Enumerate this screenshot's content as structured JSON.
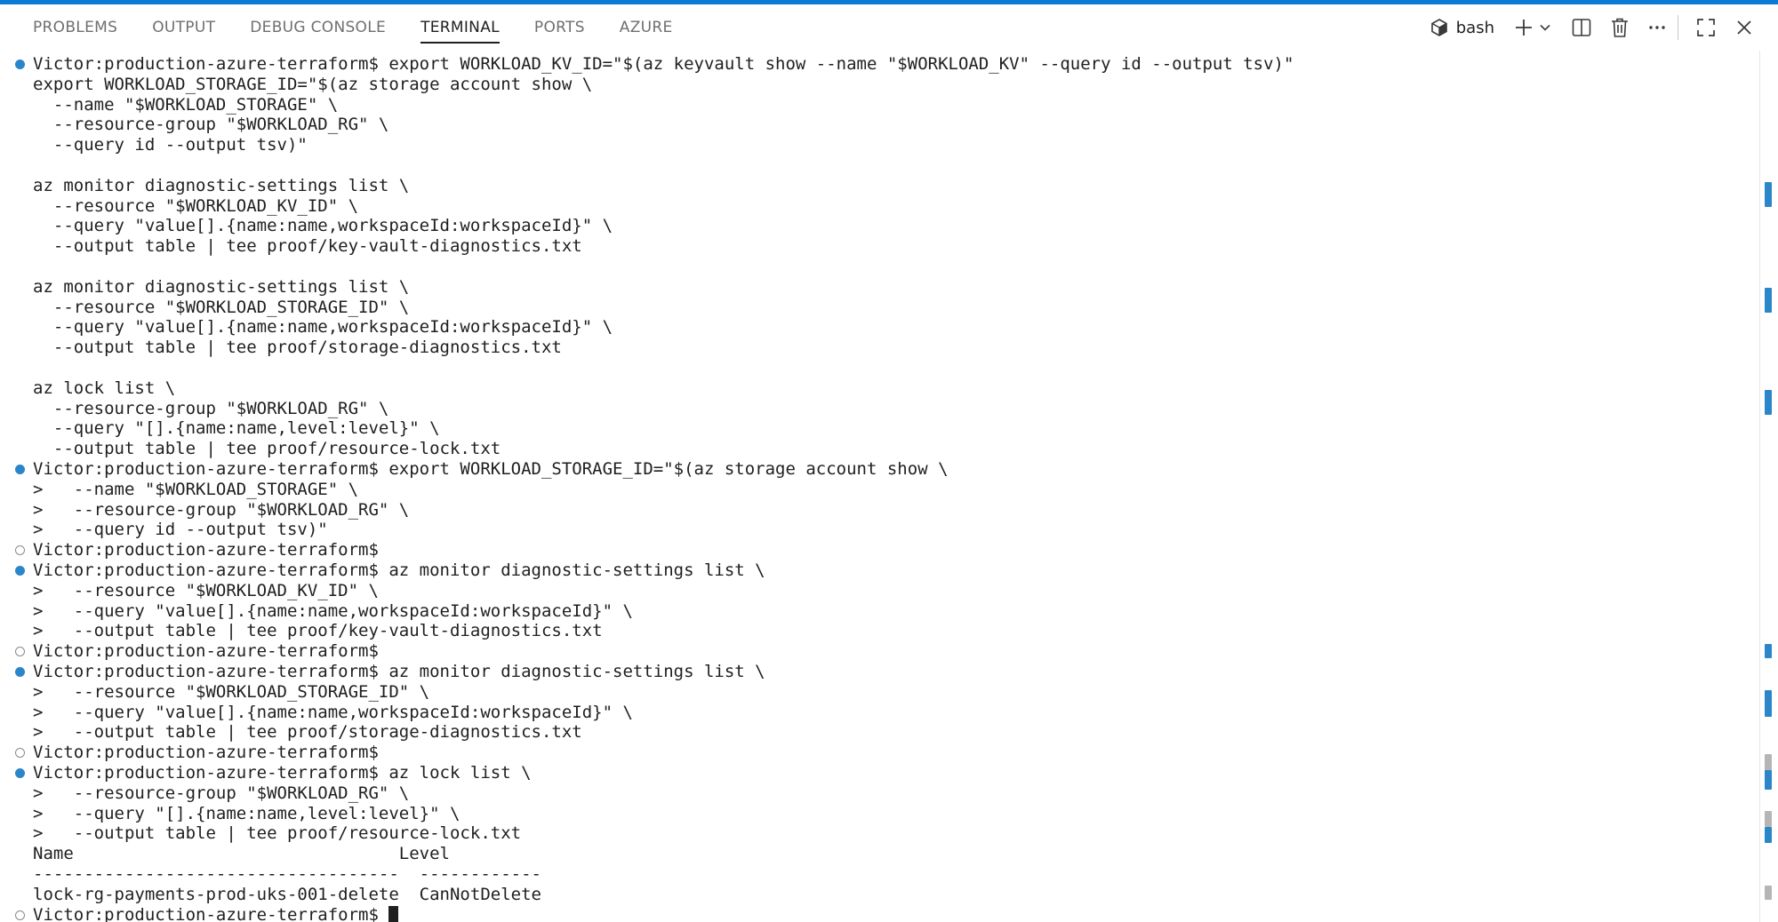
{
  "panel": {
    "tabs": [
      {
        "label": "PROBLEMS",
        "active": false
      },
      {
        "label": "OUTPUT",
        "active": false
      },
      {
        "label": "DEBUG CONSOLE",
        "active": false
      },
      {
        "label": "TERMINAL",
        "active": true
      },
      {
        "label": "PORTS",
        "active": false
      },
      {
        "label": "AZURE",
        "active": false
      }
    ],
    "terminal_name": "bash",
    "action_icons": [
      "terminal-icon",
      "plus-icon",
      "chevron-down-icon",
      "split-icon",
      "trash-icon",
      "ellipsis-icon",
      "maximize-icon",
      "close-icon"
    ]
  },
  "colors": {
    "accent": "#0a7bd5",
    "decoration_success": "#2a86c8",
    "decoration_empty": "#8a8a8a",
    "text": "#1f1f1f",
    "inactive_tab": "#6f6f6f"
  },
  "terminal": {
    "lines": [
      {
        "deco": "blue",
        "text": "Victor:production-azure-terraform$ export WORKLOAD_KV_ID=\"$(az keyvault show --name \"$WORKLOAD_KV\" --query id --output tsv)\""
      },
      {
        "deco": "none",
        "text": "export WORKLOAD_STORAGE_ID=\"$(az storage account show \\"
      },
      {
        "deco": "none",
        "text": "  --name \"$WORKLOAD_STORAGE\" \\"
      },
      {
        "deco": "none",
        "text": "  --resource-group \"$WORKLOAD_RG\" \\"
      },
      {
        "deco": "none",
        "text": "  --query id --output tsv)\""
      },
      {
        "deco": "none",
        "text": ""
      },
      {
        "deco": "none",
        "text": "az monitor diagnostic-settings list \\"
      },
      {
        "deco": "none",
        "text": "  --resource \"$WORKLOAD_KV_ID\" \\"
      },
      {
        "deco": "none",
        "text": "  --query \"value[].{name:name,workspaceId:workspaceId}\" \\"
      },
      {
        "deco": "none",
        "text": "  --output table | tee proof/key-vault-diagnostics.txt"
      },
      {
        "deco": "none",
        "text": ""
      },
      {
        "deco": "none",
        "text": "az monitor diagnostic-settings list \\"
      },
      {
        "deco": "none",
        "text": "  --resource \"$WORKLOAD_STORAGE_ID\" \\"
      },
      {
        "deco": "none",
        "text": "  --query \"value[].{name:name,workspaceId:workspaceId}\" \\"
      },
      {
        "deco": "none",
        "text": "  --output table | tee proof/storage-diagnostics.txt"
      },
      {
        "deco": "none",
        "text": ""
      },
      {
        "deco": "none",
        "text": "az lock list \\"
      },
      {
        "deco": "none",
        "text": "  --resource-group \"$WORKLOAD_RG\" \\"
      },
      {
        "deco": "none",
        "text": "  --query \"[].{name:name,level:level}\" \\"
      },
      {
        "deco": "none",
        "text": "  --output table | tee proof/resource-lock.txt"
      },
      {
        "deco": "blue",
        "text": "Victor:production-azure-terraform$ export WORKLOAD_STORAGE_ID=\"$(az storage account show \\"
      },
      {
        "deco": "none",
        "text": ">   --name \"$WORKLOAD_STORAGE\" \\"
      },
      {
        "deco": "none",
        "text": ">   --resource-group \"$WORKLOAD_RG\" \\"
      },
      {
        "deco": "none",
        "text": ">   --query id --output tsv)\""
      },
      {
        "deco": "hollow",
        "text": "Victor:production-azure-terraform$"
      },
      {
        "deco": "blue",
        "text": "Victor:production-azure-terraform$ az monitor diagnostic-settings list \\"
      },
      {
        "deco": "none",
        "text": ">   --resource \"$WORKLOAD_KV_ID\" \\"
      },
      {
        "deco": "none",
        "text": ">   --query \"value[].{name:name,workspaceId:workspaceId}\" \\"
      },
      {
        "deco": "none",
        "text": ">   --output table | tee proof/key-vault-diagnostics.txt"
      },
      {
        "deco": "hollow",
        "text": "Victor:production-azure-terraform$"
      },
      {
        "deco": "blue",
        "text": "Victor:production-azure-terraform$ az monitor diagnostic-settings list \\"
      },
      {
        "deco": "none",
        "text": ">   --resource \"$WORKLOAD_STORAGE_ID\" \\"
      },
      {
        "deco": "none",
        "text": ">   --query \"value[].{name:name,workspaceId:workspaceId}\" \\"
      },
      {
        "deco": "none",
        "text": ">   --output table | tee proof/storage-diagnostics.txt"
      },
      {
        "deco": "hollow",
        "text": "Victor:production-azure-terraform$"
      },
      {
        "deco": "blue",
        "text": "Victor:production-azure-terraform$ az lock list \\"
      },
      {
        "deco": "none",
        "text": ">   --resource-group \"$WORKLOAD_RG\" \\"
      },
      {
        "deco": "none",
        "text": ">   --query \"[].{name:name,level:level}\" \\"
      },
      {
        "deco": "none",
        "text": ">   --output table | tee proof/resource-lock.txt"
      },
      {
        "deco": "none",
        "text": "Name                                Level"
      },
      {
        "deco": "none",
        "text": "------------------------------------  ------------"
      },
      {
        "deco": "none",
        "text": "lock-rg-payments-prod-uks-001-delete  CanNotDelete"
      },
      {
        "deco": "hollow",
        "text": "Victor:production-azure-terraform$ ",
        "cursor": true
      }
    ]
  }
}
